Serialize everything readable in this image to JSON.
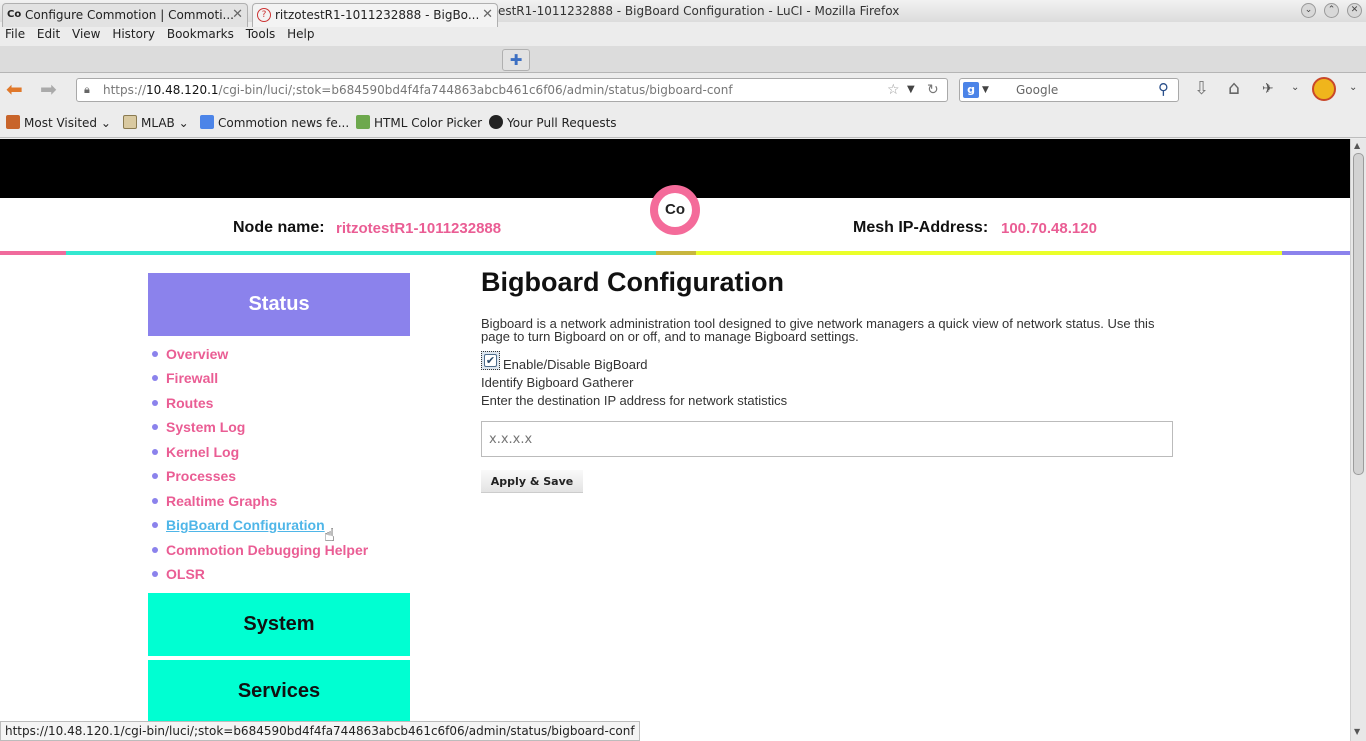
{
  "window": {
    "title": "ritzotestR1-1011232888 - BigBoard Configuration - LuCI - Mozilla Firefox"
  },
  "menubar": {
    "items": [
      "File",
      "Edit",
      "View",
      "History",
      "Bookmarks",
      "Tools",
      "Help"
    ]
  },
  "tabs": [
    {
      "label": "Configure Commotion | Commoti...",
      "icon": "Co"
    },
    {
      "label": "ritzotestR1-1011232888 - BigBo...",
      "icon": "?"
    }
  ],
  "navbar": {
    "url_prefix": "https://",
    "url_host": "10.48.120.1",
    "url_path": "/cgi-bin/luci/;stok=b684590bd4f4fa744863abcb461c6f06/admin/status/bigboard-conf",
    "search_placeholder": "Google"
  },
  "bookmarks": [
    {
      "label": "Most Visited",
      "dropdown": true,
      "icon_color": "#c8642a"
    },
    {
      "label": "MLAB",
      "dropdown": true,
      "icon_color": "#d9c9a0"
    },
    {
      "label": "Commotion news fe...",
      "dropdown": false,
      "icon_color": "#4c84e8"
    },
    {
      "label": "HTML Color Picker",
      "dropdown": false,
      "icon_color": "#6da84d"
    },
    {
      "label": "Your Pull Requests",
      "dropdown": false,
      "icon_color": "#222222"
    }
  ],
  "header": {
    "logo_text": "Co",
    "node_name_label": "Node name:",
    "node_name_value": "ritzotestR1-1011232888",
    "mesh_ip_label": "Mesh IP-Address:",
    "mesh_ip_value": "100.70.48.120"
  },
  "colors": {
    "accent_pink": "#ea5d94",
    "status_purple": "#8b82ec",
    "section_aqua": "#00ffd2",
    "stripe_yellow": "#eaff2a"
  },
  "sidebar": {
    "status_title": "Status",
    "links": [
      "Overview",
      "Firewall",
      "Routes",
      "System Log",
      "Kernel Log",
      "Processes",
      "Realtime Graphs",
      "BigBoard Configuration",
      "Commotion Debugging Helper",
      "OLSR"
    ],
    "active_link": "BigBoard Configuration",
    "system_title": "System",
    "services_title": "Services"
  },
  "main": {
    "title": "Bigboard Configuration",
    "description_line1": "Bigboard is a network administration tool designed to give network managers a quick view of network status. Use this",
    "description_line2": "page to turn Bigboard on or off, and to manage Bigboard settings.",
    "checkbox_label": "Enable/Disable BigBoard",
    "checkbox_checked": true,
    "gatherer_heading": "Identify Bigboard Gatherer",
    "gatherer_description": "Enter the destination IP address for network statistics",
    "ip_placeholder": "x.x.x.x",
    "apply_button": "Apply & Save"
  },
  "statusbar": {
    "url": "https://10.48.120.1/cgi-bin/luci/;stok=b684590bd4f4fa744863abcb461c6f06/admin/status/bigboard-conf"
  }
}
